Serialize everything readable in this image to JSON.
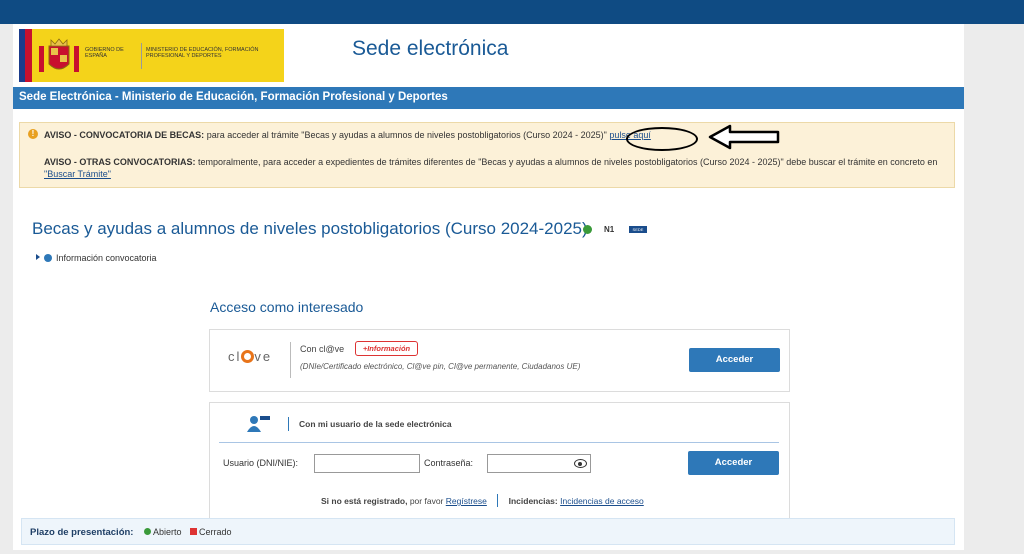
{
  "header": {
    "logo_left": "GOBIERNO DE ESPAÑA",
    "logo_right": "MINISTERIO DE EDUCACIÓN, FORMACIÓN PROFESIONAL Y DEPORTES",
    "title": "Sede electrónica"
  },
  "band": {
    "text": "Sede Electrónica - Ministerio de Educación, Formación Profesional y Deportes"
  },
  "notice": {
    "l1_bold": "AVISO - CONVOCATORIA DE BECAS:",
    "l1_text": "para acceder al trámite \"Becas y ayudas a alumnos de niveles postobligatorios (Curso 2024 - 2025)\"",
    "l1_link": "pulse aquí",
    "l2_bold": "AVISO - OTRAS CONVOCATORIAS:",
    "l2_text": "temporalmente, para acceder a expedientes de trámites diferentes de \"Becas y ayudas a alumnos de niveles postobligatorios (Curso 2024 - 2025)\" debe buscar el trámite en concreto en",
    "l2_link": "\"Buscar Trámite\""
  },
  "procedure": {
    "title": "Becas y ayudas a alumnos de niveles postobligatorios (Curso 2024-2025)",
    "level": "N1",
    "sede_badge": "SEDE",
    "info": "Información convocatoria"
  },
  "access": {
    "title": "Acceso como interesado",
    "clave_logo": "cl@ve",
    "clave_label": "Con cl@ve",
    "more_info": "+Información",
    "clave_sub": "(DNIe/Certificado electrónico, Cl@ve pin, Cl@ve permanente, Ciudadanos UE)",
    "access_button": "Acceder",
    "sede_label": "Con mi usuario de la sede electrónica",
    "user_label": "Usuario (DNI/NIE):",
    "pass_label": "Contraseña:",
    "user_value": "",
    "pass_value": "",
    "login_button": "Acceder",
    "reg_bold": "Si no está registrado,",
    "reg_text": "por favor",
    "reg_link": "Regístrese",
    "inc_bold": "Incidencias:",
    "inc_link": "Incidencias de acceso"
  },
  "plazo": {
    "label": "Plazo de presentación:",
    "open": "Abierto",
    "closed": "Cerrado"
  }
}
